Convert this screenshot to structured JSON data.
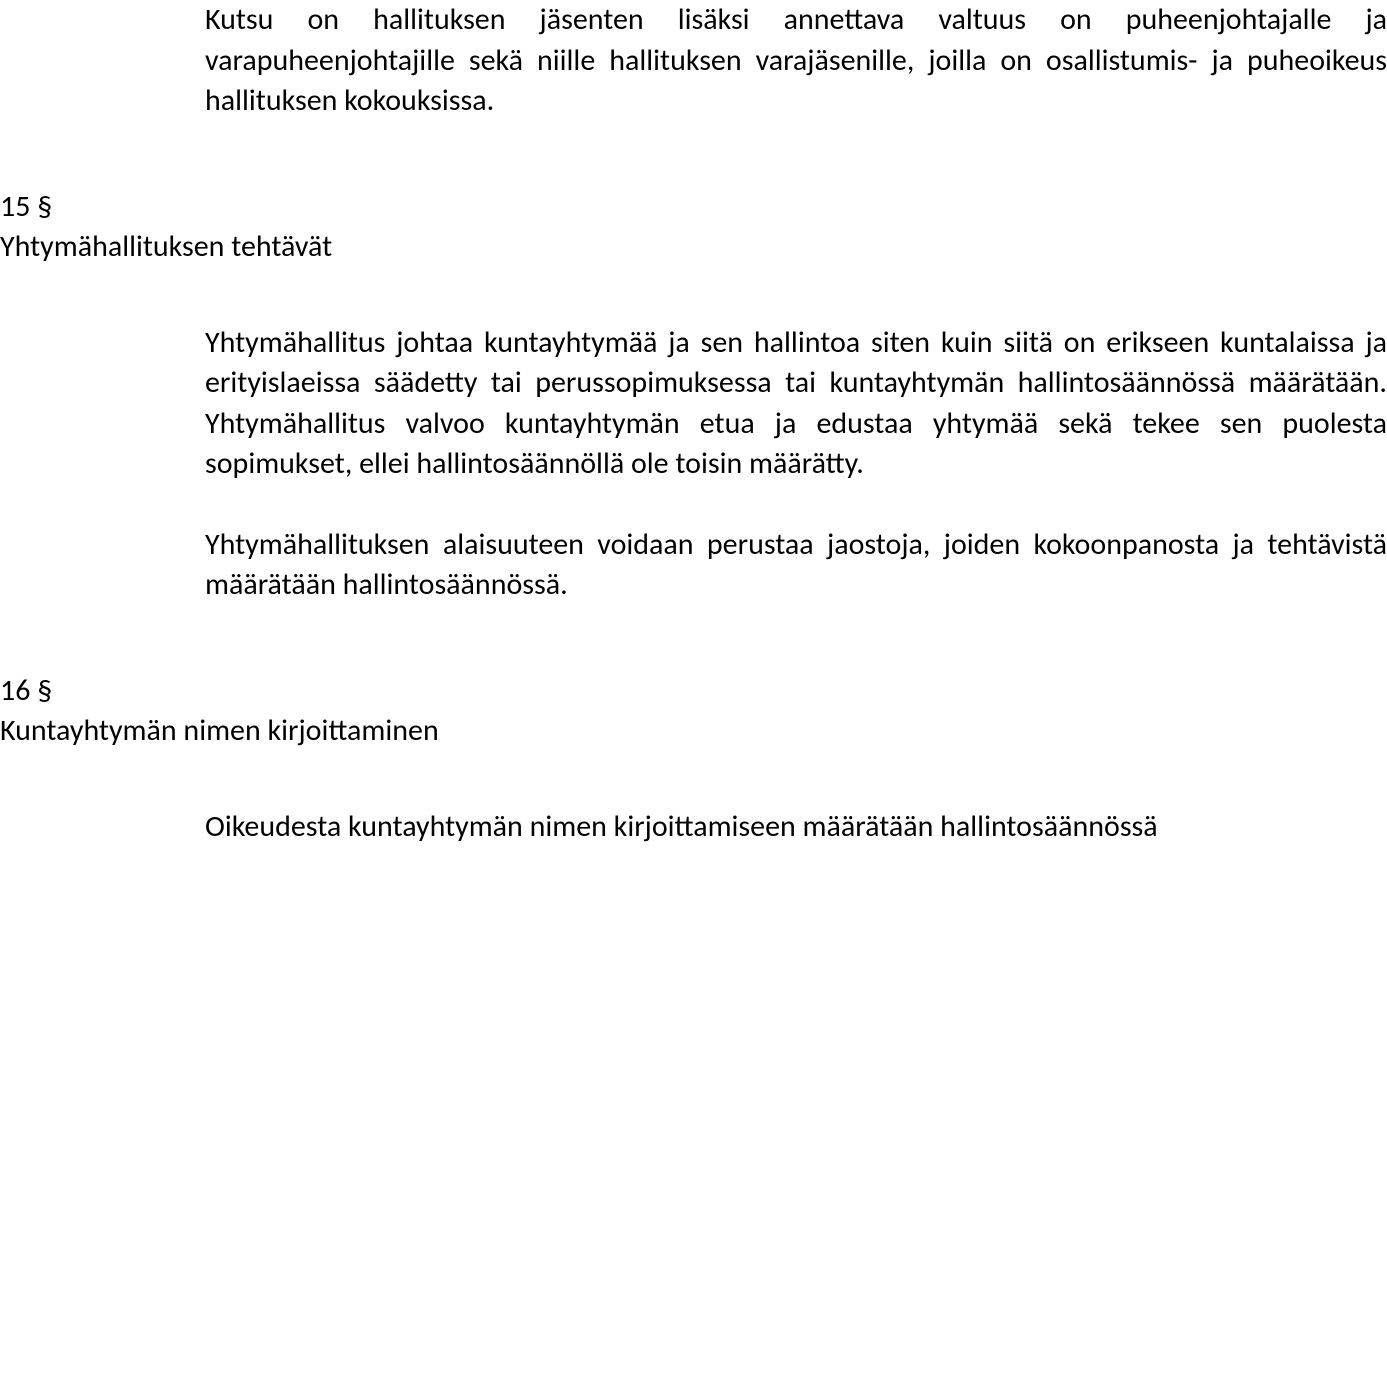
{
  "section14": {
    "paragraph1": "Kutsu on hallituksen jäsenten lisäksi annettava valtuus on puheenjohtajalle ja varapuheenjohtajille sekä niille hallituksen varajäsenille, joilla on osallistumis- ja puheoikeus hallituksen kokouksissa."
  },
  "section15": {
    "number": "15 §",
    "title": "Yhtymähallituksen tehtävät",
    "paragraph1": "Yhtymähallitus johtaa kuntayhtymää ja sen hallintoa siten kuin siitä on erikseen kuntalaissa ja erityislaeissa säädetty tai perussopimuksessa tai kuntayhtymän hallintosäännössä määrätään. Yhtymähallitus valvoo kuntayhtymän etua ja edustaa yhtymää sekä tekee sen puolesta sopimukset, ellei hallintosäännöllä ole toisin määrätty.",
    "paragraph2": "Yhtymähallituksen alaisuuteen voidaan perustaa jaostoja, joiden kokoonpanosta ja tehtävistä määrätään hallintosäännössä."
  },
  "section16": {
    "number": "16 §",
    "title": "Kuntayhtymän nimen kirjoittaminen",
    "paragraph1": "Oikeudesta kuntayhtymän nimen kirjoittamiseen määrätään hallintosäännössä"
  }
}
